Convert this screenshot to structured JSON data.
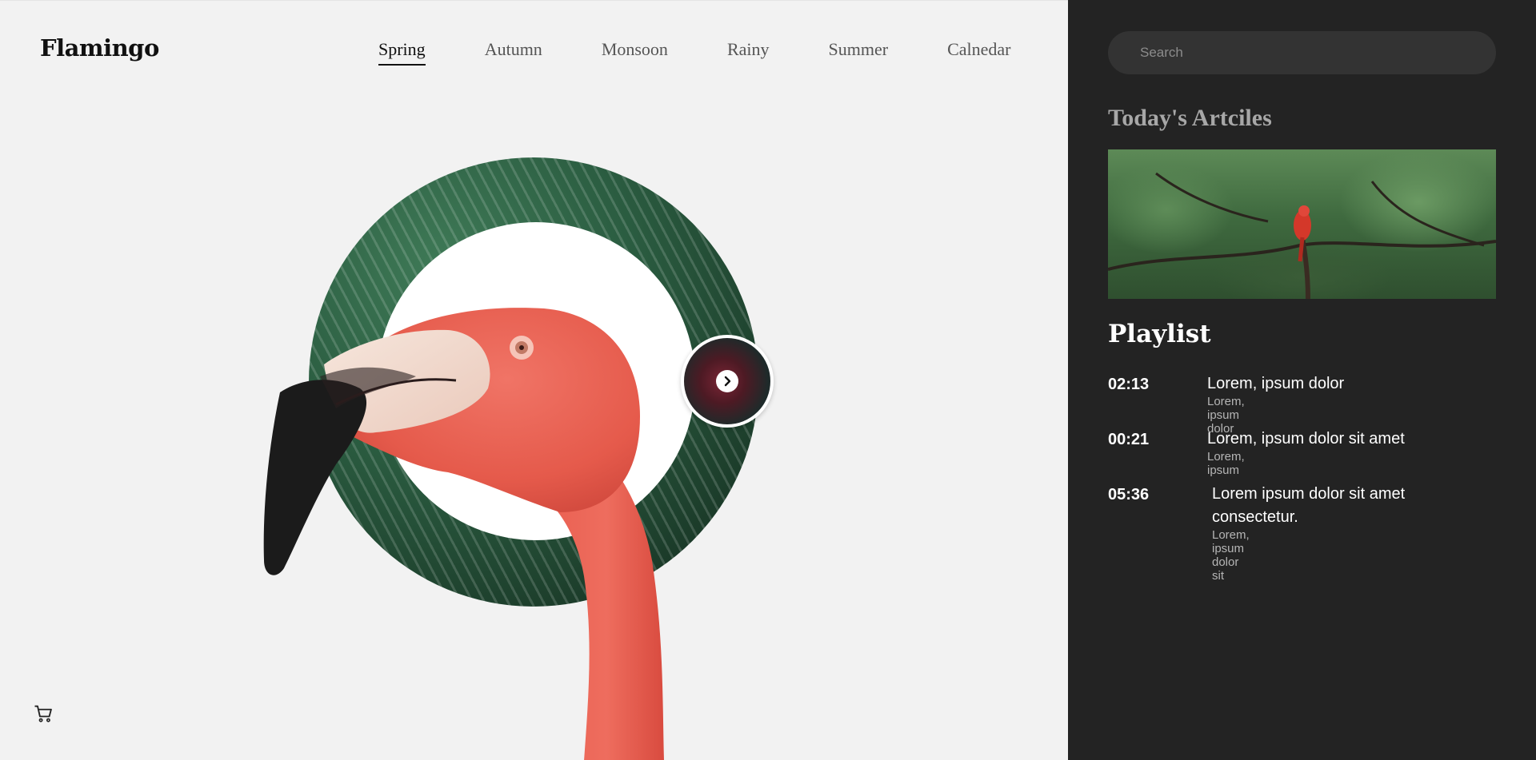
{
  "header": {
    "brand": "Flamingo",
    "nav": [
      {
        "label": "Spring",
        "active": true
      },
      {
        "label": "Autumn",
        "active": false
      },
      {
        "label": "Monsoon",
        "active": false
      },
      {
        "label": "Rainy",
        "active": false
      },
      {
        "label": "Summer",
        "active": false
      },
      {
        "label": "Calnedar",
        "active": false
      }
    ]
  },
  "hero": {
    "main_image": "flamingo-head-on-tropical-leaf-ring",
    "thumbnail_image": "flamingo-flock-thumbnail",
    "next_icon": "chevron-right-icon"
  },
  "footer": {
    "cart_icon": "cart-icon"
  },
  "sidebar": {
    "search_placeholder": "Search",
    "articles_title": "Today's Artciles",
    "article_image": "parrot-in-tree",
    "playlist_title": "Playlist",
    "tracks": [
      {
        "time": "02:13",
        "title": "Lorem, ipsum dolor",
        "subtitle": "Lorem, ipsum dolor"
      },
      {
        "time": "00:21",
        "title": "Lorem, ipsum dolor sit amet",
        "subtitle": "Lorem, ipsum"
      },
      {
        "time": "05:36",
        "title": "Lorem ipsum dolor sit amet consectetur.",
        "subtitle": "Lorem, ipsum dolor sit"
      }
    ]
  },
  "colors": {
    "main_bg": "#f2f2f2",
    "sidebar_bg": "#232323",
    "search_bg": "#333333",
    "flamingo_pink": "#ea5d4f",
    "leaf_green": "#2b5d41"
  }
}
